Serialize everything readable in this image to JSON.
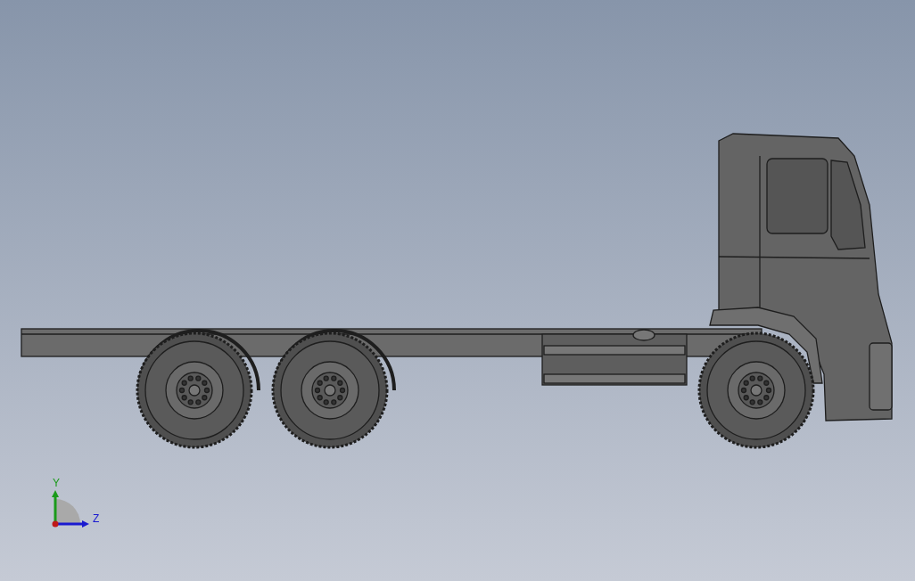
{
  "viewport": {
    "triad": {
      "axes": [
        {
          "label": "Y",
          "kind": "vertical",
          "color": "#1a9a1a"
        },
        {
          "label": "Z",
          "kind": "horizontal",
          "color": "#1a1ad0"
        }
      ]
    }
  }
}
